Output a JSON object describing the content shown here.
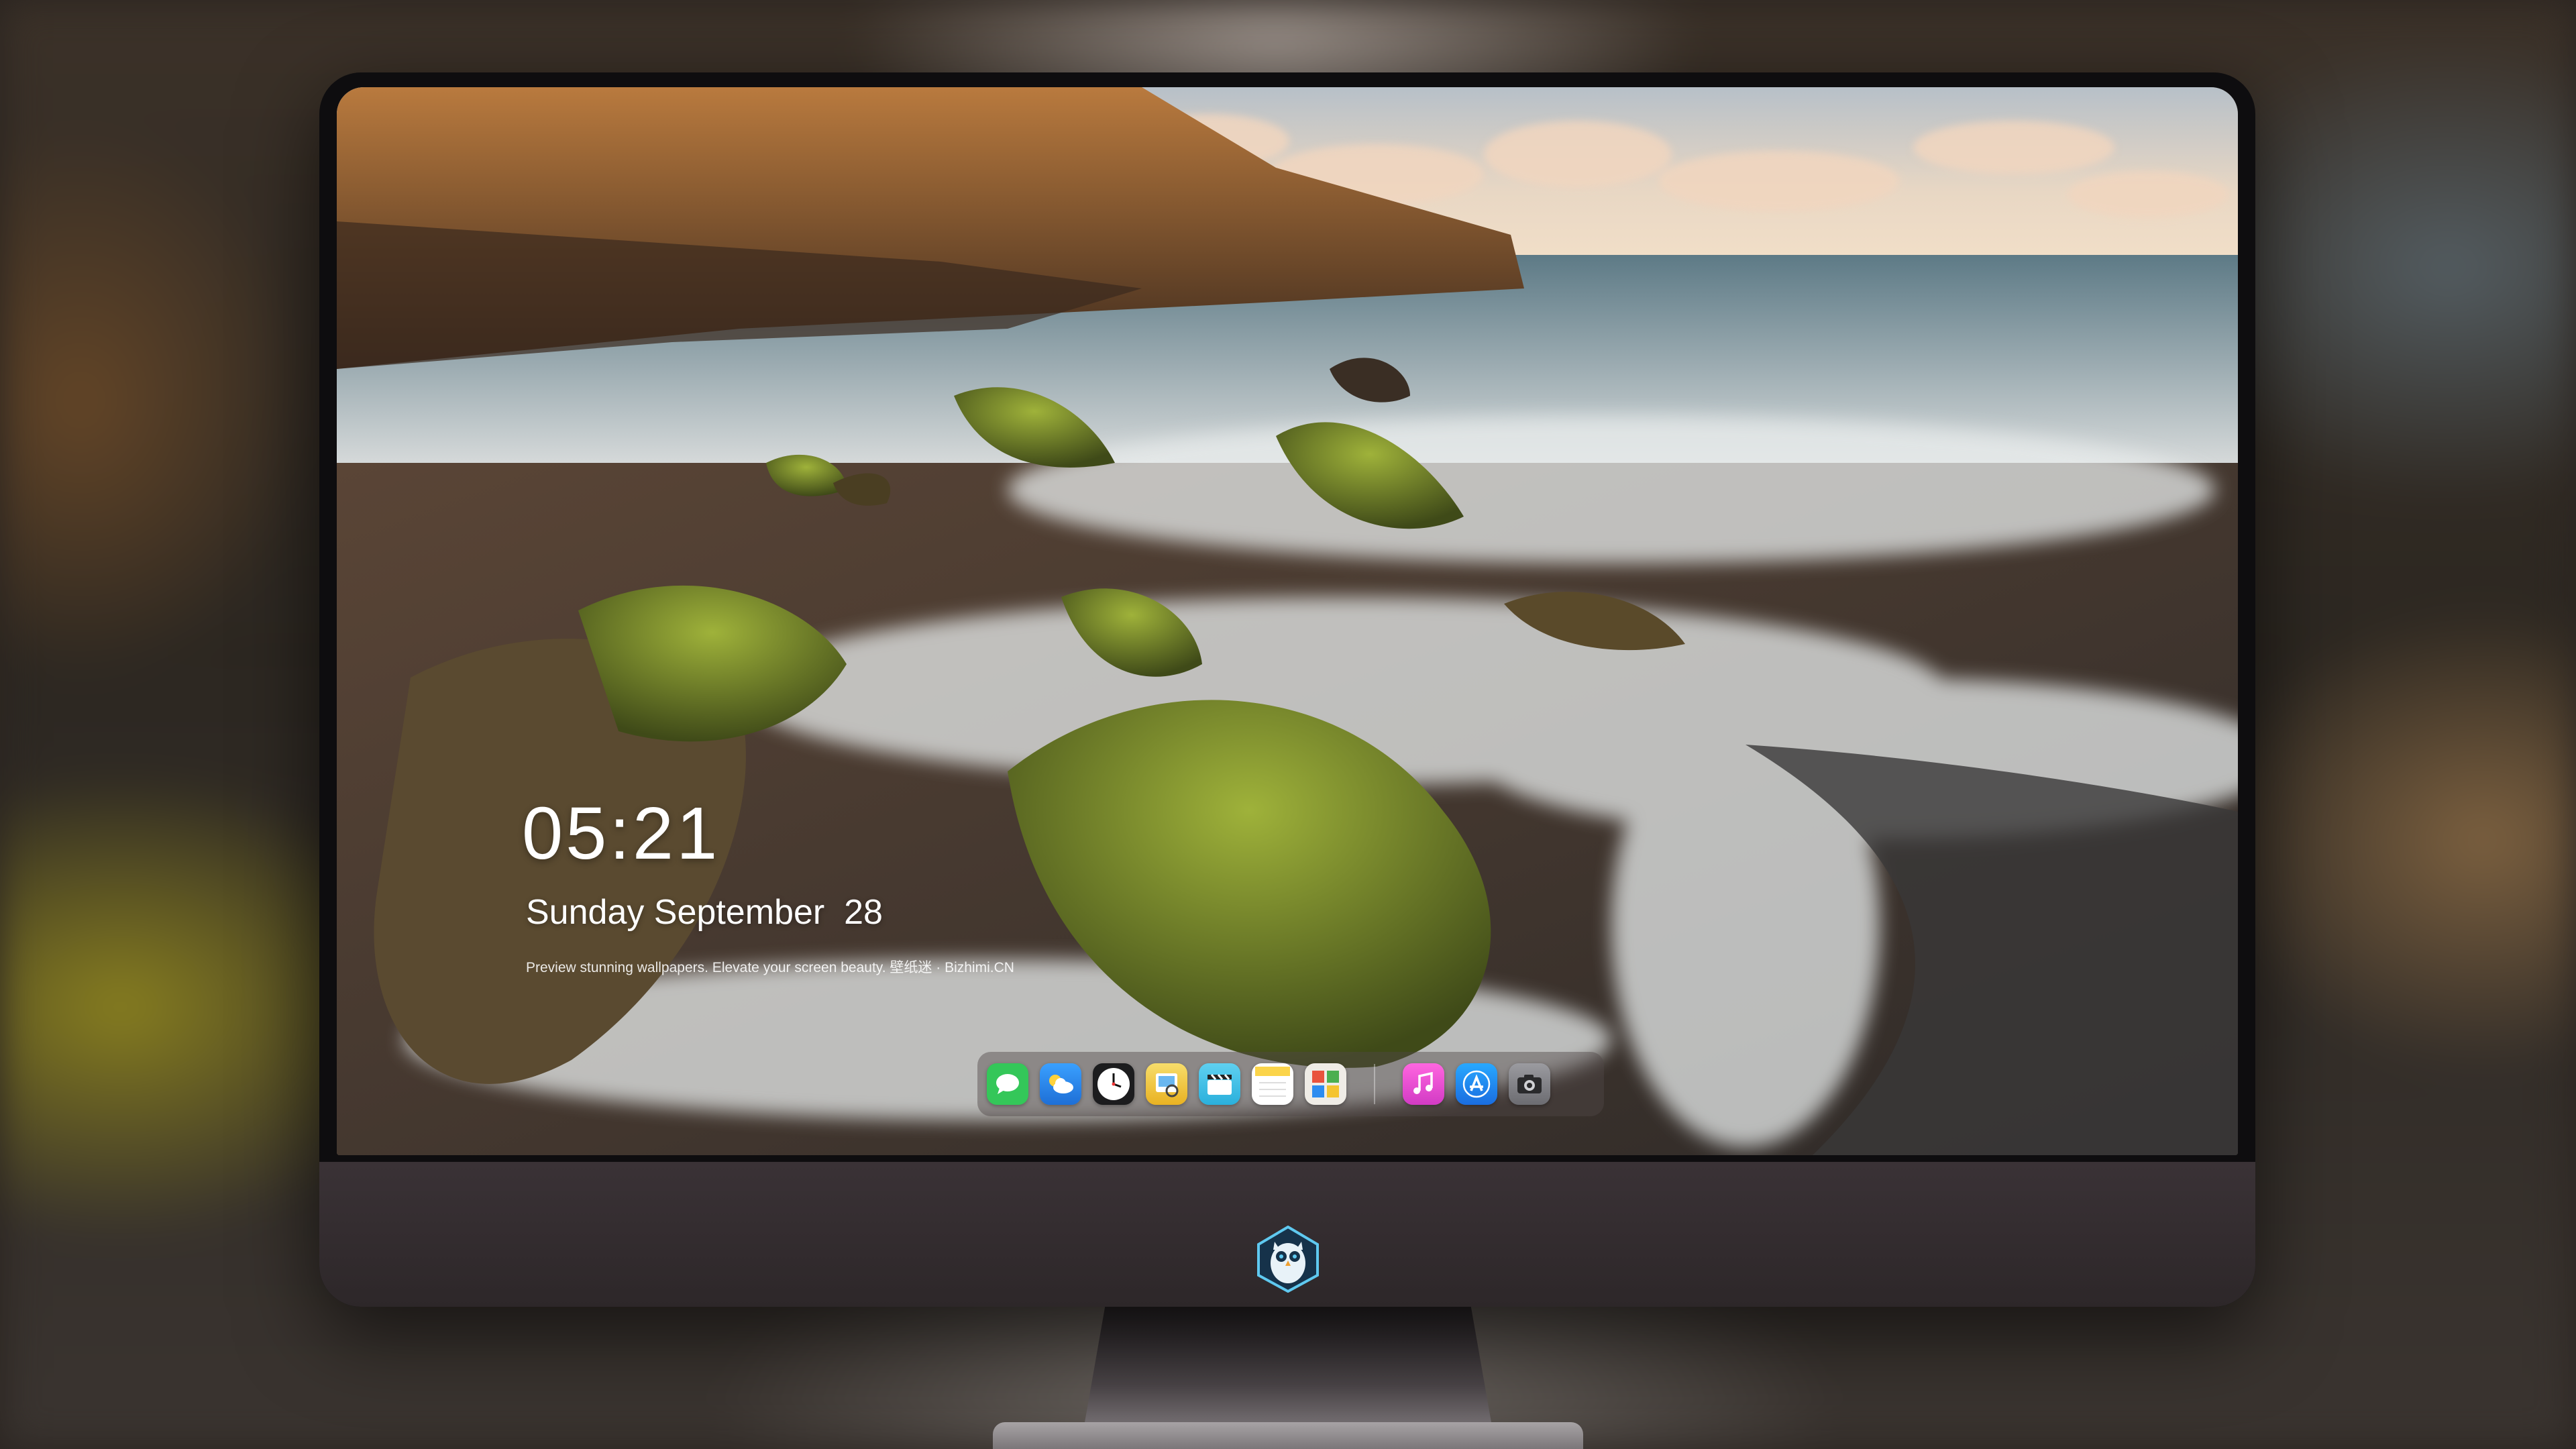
{
  "lock_screen": {
    "time": "05:21",
    "date": "Sunday September  28",
    "tagline": "Preview stunning wallpapers. Elevate your screen beauty. 壁纸迷 · Bizhimi.CN"
  },
  "dock": {
    "apps": [
      {
        "icon": "messages-icon",
        "color": "#34c759"
      },
      {
        "icon": "weather-icon",
        "color": "#2d8cf0"
      },
      {
        "icon": "clock-icon",
        "color": "#1c1c1e"
      },
      {
        "icon": "preview-icon",
        "color": "#f1c338"
      },
      {
        "icon": "clips-icon",
        "color": "#42c4e8"
      },
      {
        "icon": "notes-icon",
        "color": "#fbd44a"
      },
      {
        "icon": "photo-booth-icon",
        "color": "#e9e6e0"
      },
      {
        "icon": "music-icon",
        "color": "#f25ad4"
      },
      {
        "icon": "app-store-icon",
        "color": "#1e90ff"
      },
      {
        "icon": "camera-icon",
        "color": "#8a8a8f"
      }
    ]
  },
  "brand_logo": "owl-logo-icon"
}
